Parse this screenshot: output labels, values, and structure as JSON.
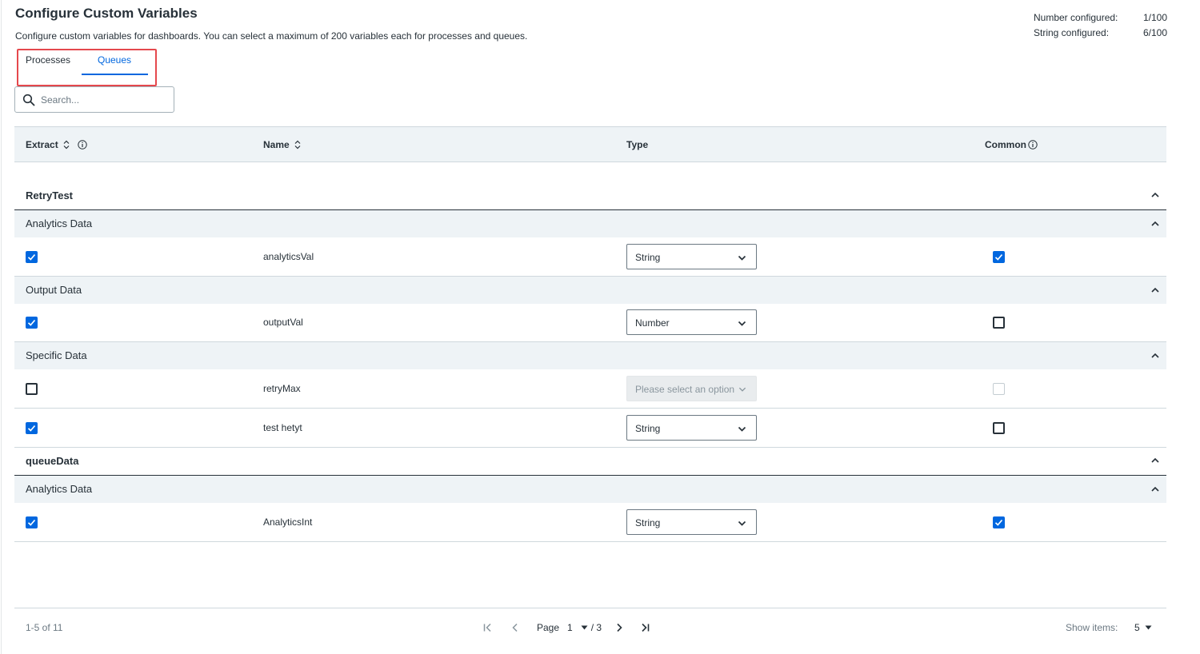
{
  "page": {
    "title": "Configure Custom Variables",
    "subtitle": "Configure custom variables for dashboards. You can select a maximum of 200 variables each for processes and queues."
  },
  "counts": {
    "number_label": "Number configured:",
    "number_value": "1/100",
    "string_label": "String configured:",
    "string_value": "6/100"
  },
  "tabs": [
    {
      "label": "Processes",
      "active": false
    },
    {
      "label": "Queues",
      "active": true
    }
  ],
  "search": {
    "placeholder": "Search...",
    "value": ""
  },
  "table": {
    "columns": {
      "extract": "Extract",
      "name": "Name",
      "type": "Type",
      "common": "Common"
    },
    "groups": [
      {
        "label": "RetryTest",
        "subgroups": [
          {
            "label": "Analytics Data",
            "rows": [
              {
                "name": "analyticsVal",
                "extract": true,
                "type": "String",
                "common": true,
                "disabled": false
              }
            ]
          },
          {
            "label": "Output Data",
            "rows": [
              {
                "name": "outputVal",
                "extract": true,
                "type": "Number",
                "common": false,
                "disabled": false
              }
            ]
          },
          {
            "label": "Specific Data",
            "rows": [
              {
                "name": "retryMax",
                "extract": false,
                "type": "Please select an option",
                "common": false,
                "disabled": true
              },
              {
                "name": "test hetyt",
                "extract": true,
                "type": "String",
                "common": false,
                "disabled": false
              }
            ]
          }
        ]
      },
      {
        "label": "queueData",
        "subgroups": [
          {
            "label": "Analytics Data",
            "rows": [
              {
                "name": "AnalyticsInt",
                "extract": true,
                "type": "String",
                "common": true,
                "disabled": false
              }
            ]
          }
        ]
      }
    ]
  },
  "footer": {
    "range": "1-5 of 11",
    "page_label": "Page",
    "page": "1",
    "total": "/ 3",
    "show_items_label": "Show items:",
    "page_size": "5"
  },
  "colors": {
    "accent": "#0067df",
    "highlight": "#e5484d"
  },
  "icons": [
    "search-icon",
    "sort-icon",
    "info-icon",
    "chevron-up-icon",
    "chevron-down-icon",
    "check-icon",
    "first-page-icon",
    "prev-page-icon",
    "next-page-icon",
    "last-page-icon",
    "caret-down-icon"
  ]
}
